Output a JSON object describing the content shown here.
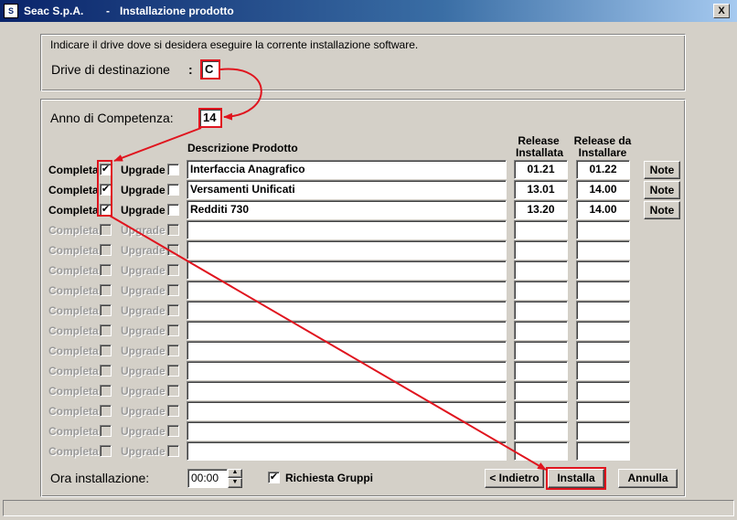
{
  "window": {
    "app_name": "Seac S.p.A.",
    "separator": "-",
    "title": "Installazione prodotto",
    "close_glyph": "X"
  },
  "drive_group": {
    "instruction": "Indicare il drive dove si desidera eseguire la corrente installazione software.",
    "drive_label": "Drive di destinazione",
    "drive_colon": ":",
    "drive_value": "C"
  },
  "products_group": {
    "anno_label": "Anno di Competenza:",
    "anno_value": "14",
    "col_descrizione": "Descrizione Prodotto",
    "col_installata_1": "Release",
    "col_installata_2": "Installata",
    "col_installare_1": "Release da",
    "col_installare_2": "Installare",
    "completa_label": "Completa",
    "upgrade_label": "Upgrade",
    "note_label": "Note",
    "check_glyph": "✔",
    "rows": [
      {
        "descrizione": "Interfaccia Anagrafico",
        "installata": "01.21",
        "installare": "01.22",
        "completa": true,
        "upgrade": false
      },
      {
        "descrizione": "Versamenti Unificati",
        "installata": "13.01",
        "installare": "14.00",
        "completa": true,
        "upgrade": false
      },
      {
        "descrizione": "Redditi 730",
        "installata": "13.20",
        "installare": "14.00",
        "completa": true,
        "upgrade": false
      }
    ],
    "empty_rows": 12
  },
  "footer": {
    "ora_label": "Ora installazione:",
    "ora_value": "00:00",
    "richiesta_label": "Richiesta Gruppi",
    "richiesta_checked": true,
    "indietro_label": "< Indietro",
    "installa_label": "Installa",
    "annulla_label": "Annulla"
  },
  "colors": {
    "annotation_red": "#e0141e",
    "window_bg": "#d4d0c8",
    "titlebar": "#0a246a"
  }
}
